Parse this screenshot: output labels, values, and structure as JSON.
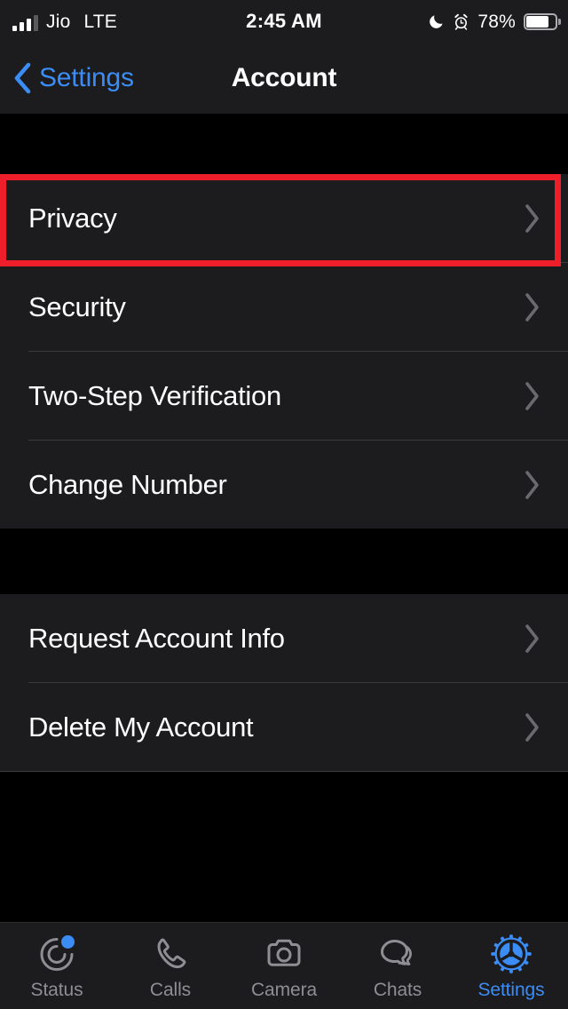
{
  "status_bar": {
    "carrier": "Jio",
    "network_type": "LTE",
    "time": "2:45 AM",
    "battery_percent": "78%",
    "dnd_icon": "moon-icon",
    "alarm_icon": "alarm-icon",
    "signal_icon": "signal-bars-icon",
    "battery_icon": "battery-icon",
    "signal_bars_filled": 3,
    "signal_bars_total": 4
  },
  "nav_bar": {
    "back_label": "Settings",
    "back_icon": "chevron-left-icon",
    "title": "Account"
  },
  "groups": [
    {
      "id": "account-settings-group",
      "rows": [
        {
          "label": "Privacy",
          "name": "privacy",
          "highlighted": true
        },
        {
          "label": "Security",
          "name": "security",
          "highlighted": false
        },
        {
          "label": "Two-Step Verification",
          "name": "two-step-verification",
          "highlighted": false
        },
        {
          "label": "Change Number",
          "name": "change-number",
          "highlighted": false
        }
      ]
    },
    {
      "id": "account-data-group",
      "rows": [
        {
          "label": "Request Account Info",
          "name": "request-account-info",
          "highlighted": false
        },
        {
          "label": "Delete My Account",
          "name": "delete-my-account",
          "highlighted": false
        }
      ]
    }
  ],
  "highlight": {
    "color": "#ee1f2a",
    "target": "Privacy"
  },
  "tab_bar": {
    "tabs": [
      {
        "label": "Status",
        "icon": "status-rings-icon",
        "active": false,
        "badge": true
      },
      {
        "label": "Calls",
        "icon": "phone-icon",
        "active": false,
        "badge": false
      },
      {
        "label": "Camera",
        "icon": "camera-icon",
        "active": false,
        "badge": false
      },
      {
        "label": "Chats",
        "icon": "chat-bubbles-icon",
        "active": false,
        "badge": false
      },
      {
        "label": "Settings",
        "icon": "gear-icon",
        "active": true,
        "badge": false
      }
    ],
    "active_color": "#3b8cf5",
    "inactive_color": "#8e8e93"
  },
  "colors": {
    "accent": "#3b8cf5",
    "row_background": "#1c1c1e",
    "page_background": "#000000",
    "separator": "#3a3a3c",
    "highlight_red": "#ee1f2a"
  }
}
